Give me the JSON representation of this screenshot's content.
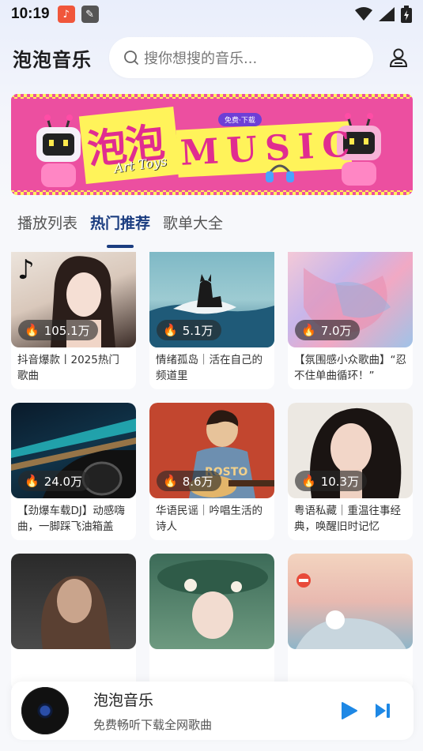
{
  "status": {
    "time": "10:19"
  },
  "header": {
    "title": "泡泡音乐",
    "search_placeholder": "搜你想搜的音乐..."
  },
  "banner": {
    "text_main": "泡泡",
    "text_music": "MUSIC",
    "badge": "免费·下载",
    "brand": "Art Toys"
  },
  "tabs": [
    {
      "label": "播放列表",
      "active": false
    },
    {
      "label": "热门推荐",
      "active": true
    },
    {
      "label": "歌单大全",
      "active": false
    }
  ],
  "cards": [
    {
      "plays": "105.1万",
      "title": "抖音爆款丨2025热门歌曲"
    },
    {
      "plays": "5.1万",
      "title": "情绪孤岛｜活在自己的频道里"
    },
    {
      "plays": "7.0万",
      "title": "【氛围感小众歌曲】“忍不住单曲循环！”"
    },
    {
      "plays": "24.0万",
      "title": "【劲爆车载DJ】动感嗨曲，一脚踩飞油箱盖"
    },
    {
      "plays": "8.6万",
      "title": "华语民谣｜吟唱生活的诗人"
    },
    {
      "plays": "10.3万",
      "title": "粤语私藏｜重温往事经典，唤醒旧时记忆"
    },
    {
      "plays": "",
      "title": ""
    },
    {
      "plays": "",
      "title": ""
    },
    {
      "plays": "",
      "title": ""
    }
  ],
  "player": {
    "title": "泡泡音乐",
    "subtitle": "免费畅听下载全网歌曲"
  },
  "colors": {
    "accent": "#1b3d80",
    "play": "#1e88e5",
    "banner": "#ec4fa0"
  }
}
